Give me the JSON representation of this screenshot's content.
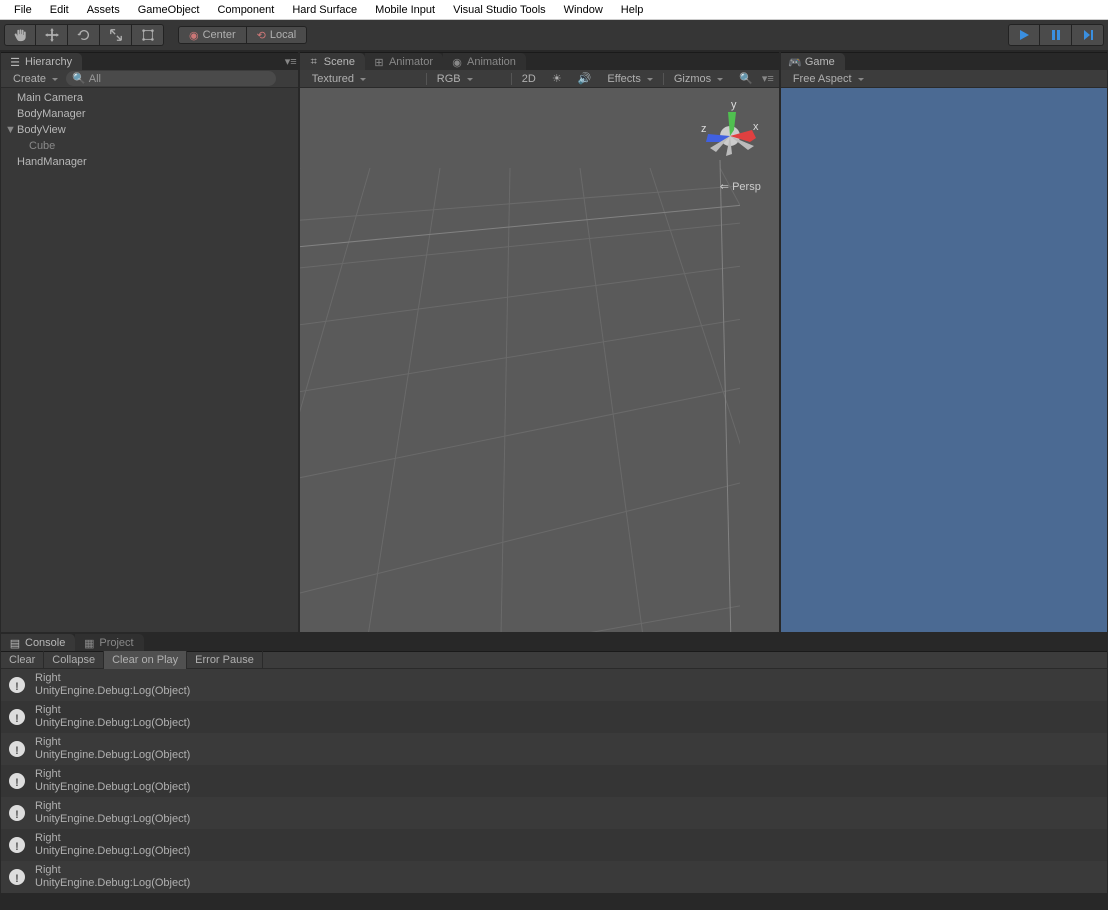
{
  "menu": [
    "File",
    "Edit",
    "Assets",
    "GameObject",
    "Component",
    "Hard Surface",
    "Mobile Input",
    "Visual Studio Tools",
    "Window",
    "Help"
  ],
  "toolbar": {
    "pivot_center": "Center",
    "pivot_local": "Local"
  },
  "hierarchy_panel": {
    "title": "Hierarchy",
    "create_label": "Create",
    "search_placeholder": "All",
    "items": [
      {
        "label": "Main Camera",
        "indent": 0
      },
      {
        "label": "BodyManager",
        "indent": 0
      },
      {
        "label": "BodyView",
        "indent": 0,
        "expanded": true
      },
      {
        "label": "Cube",
        "indent": 1
      },
      {
        "label": "HandManager",
        "indent": 0
      }
    ]
  },
  "scene_panel": {
    "tabs": [
      {
        "label": "Scene",
        "active": true
      },
      {
        "label": "Animator",
        "active": false
      },
      {
        "label": "Animation",
        "active": false
      }
    ],
    "tb": {
      "shading": "Textured",
      "render": "RGB",
      "toggle2d": "2D",
      "effects": "Effects",
      "gizmos": "Gizmos"
    },
    "gizmo_axes": {
      "x": "x",
      "y": "y",
      "z": "z"
    },
    "persp_label": "Persp"
  },
  "game_panel": {
    "title": "Game",
    "aspect": "Free Aspect"
  },
  "bottom_panel": {
    "tabs": [
      {
        "label": "Console",
        "active": true
      },
      {
        "label": "Project",
        "active": false
      }
    ],
    "buttons": {
      "clear": "Clear",
      "collapse": "Collapse",
      "clear_on_play": "Clear on Play",
      "error_pause": "Error Pause"
    },
    "logs": [
      {
        "msg": "Right",
        "trace": "UnityEngine.Debug:Log(Object)"
      },
      {
        "msg": "Right",
        "trace": "UnityEngine.Debug:Log(Object)"
      },
      {
        "msg": "Right",
        "trace": "UnityEngine.Debug:Log(Object)"
      },
      {
        "msg": "Right",
        "trace": "UnityEngine.Debug:Log(Object)"
      },
      {
        "msg": "Right",
        "trace": "UnityEngine.Debug:Log(Object)"
      },
      {
        "msg": "Right",
        "trace": "UnityEngine.Debug:Log(Object)"
      },
      {
        "msg": "Right",
        "trace": "UnityEngine.Debug:Log(Object)"
      }
    ]
  }
}
